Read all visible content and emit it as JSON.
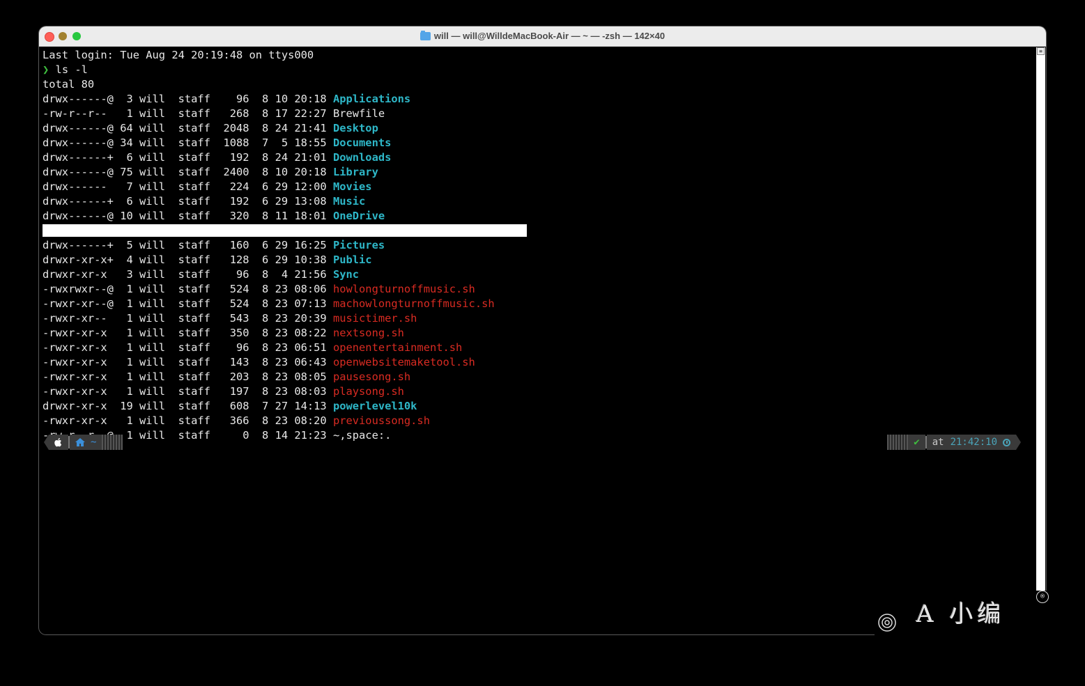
{
  "window": {
    "title": "will — will@WilldeMacBook-Air — ~ — -zsh — 142×40",
    "folder_icon": "folder-icon"
  },
  "terminal": {
    "last_login": "Last login: Tue Aug 24 20:19:48 on ttys000",
    "prompt_symbol": "❯",
    "command": " ls -l",
    "total": "total 80",
    "listing_top": [
      {
        "meta": "drwx------@  3 will  staff    96  8 10 20:18 ",
        "name": "Applications",
        "kind": "dir"
      },
      {
        "meta": "-rw-r--r--   1 will  staff   268  8 17 22:27 ",
        "name": "Brewfile",
        "kind": "file"
      },
      {
        "meta": "drwx------@ 64 will  staff  2048  8 24 21:41 ",
        "name": "Desktop",
        "kind": "dir"
      },
      {
        "meta": "drwx------@ 34 will  staff  1088  7  5 18:55 ",
        "name": "Documents",
        "kind": "dir"
      },
      {
        "meta": "drwx------+  6 will  staff   192  8 24 21:01 ",
        "name": "Downloads",
        "kind": "dir"
      },
      {
        "meta": "drwx------@ 75 will  staff  2400  8 10 20:18 ",
        "name": "Library",
        "kind": "dir"
      },
      {
        "meta": "drwx------   7 will  staff   224  6 29 12:00 ",
        "name": "Movies",
        "kind": "dir"
      },
      {
        "meta": "drwx------+  6 will  staff   192  6 29 13:08 ",
        "name": "Music",
        "kind": "dir"
      },
      {
        "meta": "drwx------@ 10 will  staff   320  8 11 18:01 ",
        "name": "OneDrive",
        "kind": "dir"
      }
    ],
    "listing_bottom": [
      {
        "meta": "drwx------+  5 will  staff   160  6 29 16:25 ",
        "name": "Pictures",
        "kind": "dir"
      },
      {
        "meta": "drwxr-xr-x+  4 will  staff   128  6 29 10:38 ",
        "name": "Public",
        "kind": "dir"
      },
      {
        "meta": "drwxr-xr-x   3 will  staff    96  8  4 21:56 ",
        "name": "Sync",
        "kind": "dir"
      },
      {
        "meta": "-rwxrwxr--@  1 will  staff   524  8 23 08:06 ",
        "name": "howlongturnoffmusic.sh",
        "kind": "exec"
      },
      {
        "meta": "-rwxr-xr--@  1 will  staff   524  8 23 07:13 ",
        "name": "machowlongturnoffmusic.sh",
        "kind": "exec"
      },
      {
        "meta": "-rwxr-xr--   1 will  staff   543  8 23 20:39 ",
        "name": "musictimer.sh",
        "kind": "exec"
      },
      {
        "meta": "-rwxr-xr-x   1 will  staff   350  8 23 08:22 ",
        "name": "nextsong.sh",
        "kind": "exec"
      },
      {
        "meta": "-rwxr-xr-x   1 will  staff    96  8 23 06:51 ",
        "name": "openentertainment.sh",
        "kind": "exec"
      },
      {
        "meta": "-rwxr-xr-x   1 will  staff   143  8 23 06:43 ",
        "name": "openwebsitemaketool.sh",
        "kind": "exec"
      },
      {
        "meta": "-rwxr-xr-x   1 will  staff   203  8 23 08:05 ",
        "name": "pausesong.sh",
        "kind": "exec"
      },
      {
        "meta": "-rwxr-xr-x   1 will  staff   197  8 23 08:03 ",
        "name": "playsong.sh",
        "kind": "exec"
      },
      {
        "meta": "drwxr-xr-x  19 will  staff   608  7 27 14:13 ",
        "name": "powerlevel10k",
        "kind": "dir"
      },
      {
        "meta": "-rwxr-xr-x   1 will  staff   366  8 23 08:20 ",
        "name": "previoussong.sh",
        "kind": "exec"
      },
      {
        "meta": "-rw-r--r--@  1 will  staff     0  8 14 21:23 ",
        "name": "~,space:.",
        "kind": "file"
      }
    ]
  },
  "prompt": {
    "left": {
      "os_icon": "apple-icon",
      "home_icon": "home-icon",
      "path": "~"
    },
    "right": {
      "status_icon": "✔",
      "at_label": "at",
      "time": "21:42:10",
      "clock_icon": "clock-icon"
    }
  },
  "colors": {
    "dir": "#2eb7c8",
    "exec": "#d92b22",
    "file": "#e8e8e8",
    "prompt_green": "#3fbf3f"
  },
  "watermark": {
    "text": "A 小编",
    "mark": "®"
  }
}
